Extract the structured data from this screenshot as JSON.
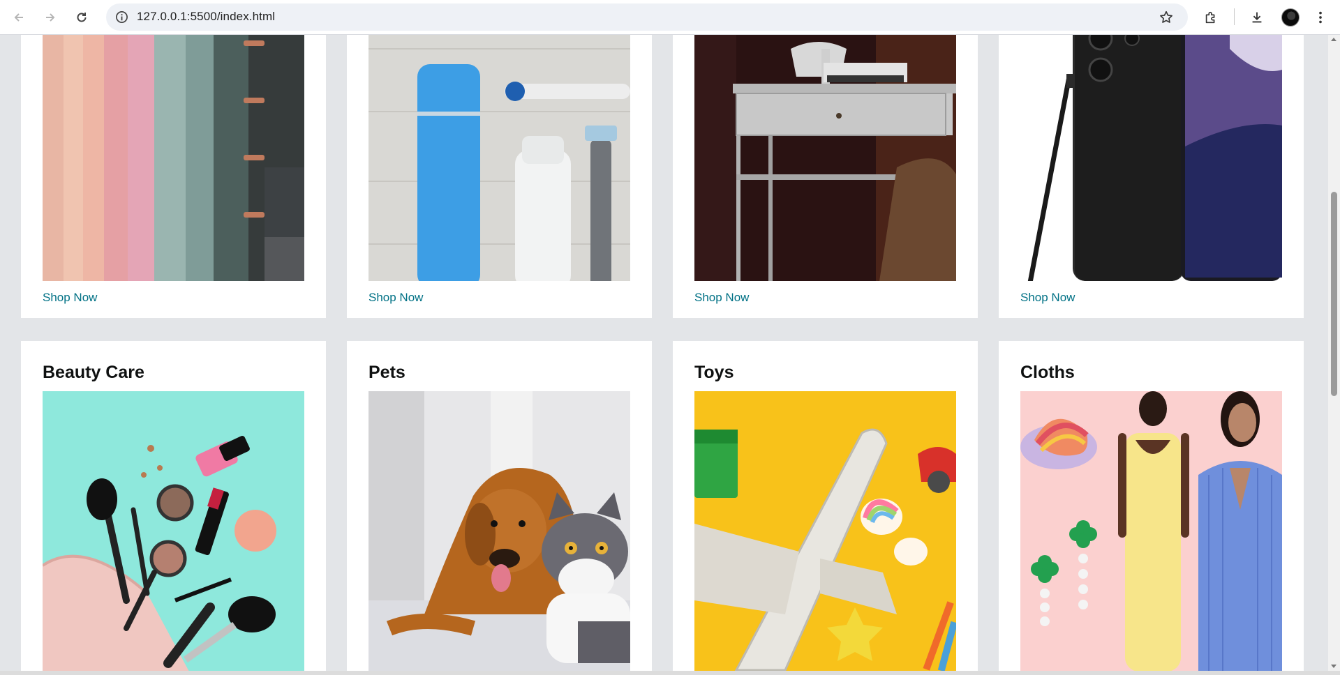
{
  "browser": {
    "url": "127.0.0.1:5500/index.html"
  },
  "cards_top": [
    {
      "image": "curtains-image",
      "link": "Shop Now"
    },
    {
      "image": "personal-care-image",
      "link": "Shop Now"
    },
    {
      "image": "desk-furniture-image",
      "link": "Shop Now"
    },
    {
      "image": "smartphone-image",
      "link": "Shop Now"
    }
  ],
  "cards_bottom": [
    {
      "title": "Beauty Care",
      "image": "makeup-image"
    },
    {
      "title": "Pets",
      "image": "dog-and-cat-image"
    },
    {
      "title": "Toys",
      "image": "toy-airplane-image"
    },
    {
      "title": "Cloths",
      "image": "fashion-models-image"
    }
  ],
  "colors": {
    "link": "#007185",
    "page_bg": "#e3e5e8",
    "card_bg": "#ffffff"
  }
}
